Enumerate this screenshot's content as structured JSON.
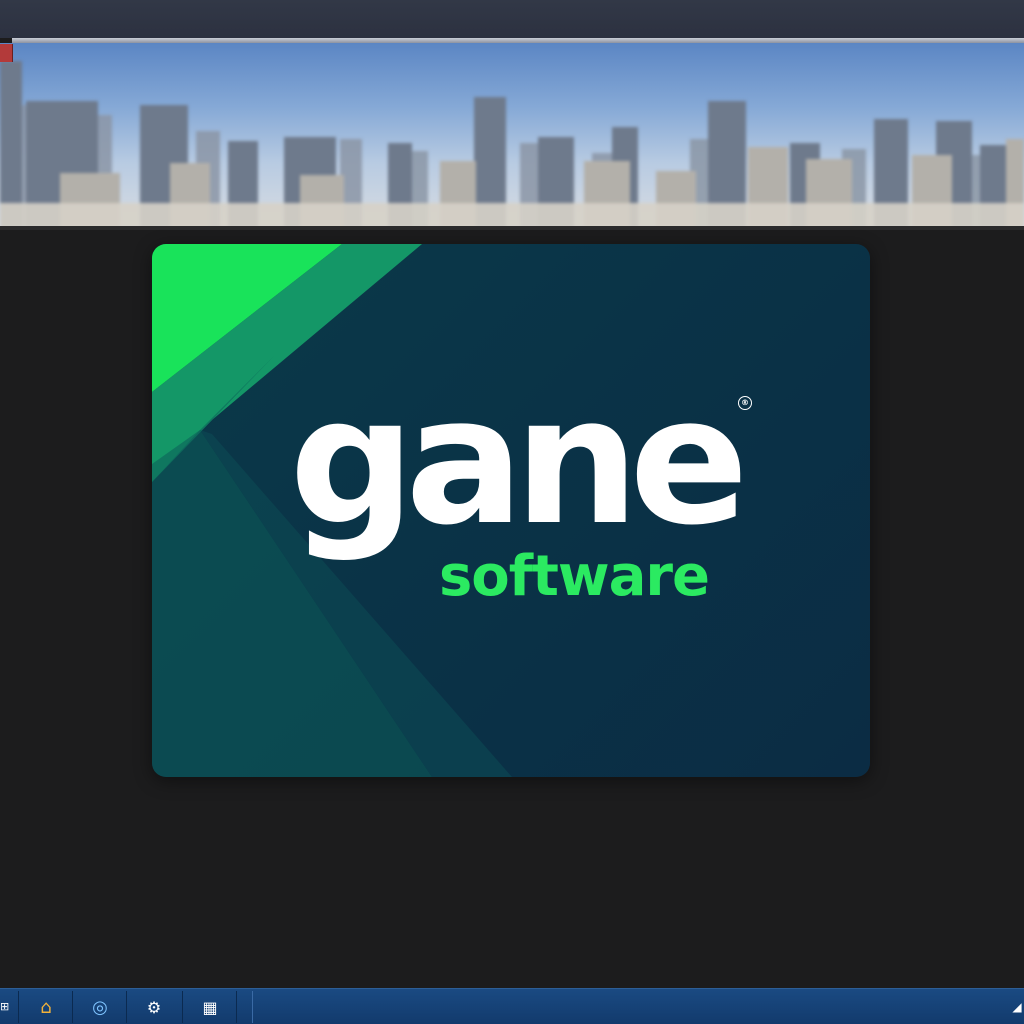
{
  "card": {
    "logo_word": "gane",
    "logo_registered": "®",
    "logo_sub": "software",
    "colors": {
      "card_background": "#0a3347",
      "accent_green": "#2bea61",
      "logo_text": "#ffffff"
    }
  },
  "banner": {
    "image": "city-skyline-photo"
  },
  "taskbar": {
    "start_label": "⊞",
    "buttons": [
      {
        "icon": "home-icon",
        "glyph": "⌂"
      },
      {
        "icon": "browser-icon",
        "glyph": "◎"
      },
      {
        "icon": "settings-icon",
        "glyph": "⚙"
      },
      {
        "icon": "calculator-icon",
        "glyph": "▦"
      }
    ],
    "tray_glyph": "◢",
    "colors": {
      "taskbar": "#123a6c"
    }
  }
}
